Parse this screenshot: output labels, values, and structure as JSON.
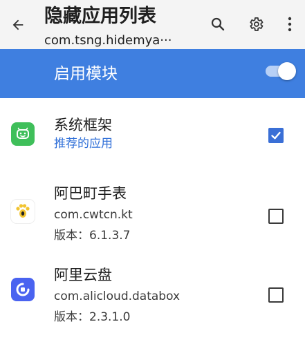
{
  "appbar": {
    "title": "隐藏应用列表",
    "subtitle": "com.tsng.hidemya···",
    "icons": [
      "back-arrow-icon",
      "search-icon",
      "gear-icon",
      "more-vert-icon"
    ]
  },
  "module": {
    "label": "启用模块",
    "enabled": true
  },
  "apps": [
    {
      "name": "系统框架",
      "tag": "推荐的应用",
      "checked": true,
      "icon": "android-system-icon",
      "icon_color": "#3fbf5a"
    },
    {
      "name": "阿巴町手表",
      "package": "com.cwtcn.kt",
      "version": "版本：6.1.3.7",
      "checked": false,
      "icon": "paw-icon",
      "icon_color": "#f2c431"
    },
    {
      "name": "阿里云盘",
      "package": "com.alicloud.databox",
      "version": "版本：2.3.1.0",
      "checked": false,
      "icon": "cloud-disk-icon",
      "icon_color": "#4a63f0"
    }
  ],
  "colors": {
    "accent": "#3f7fe0",
    "appbar_bg": "#f4f4f4",
    "link_blue": "#2f6fd8"
  }
}
